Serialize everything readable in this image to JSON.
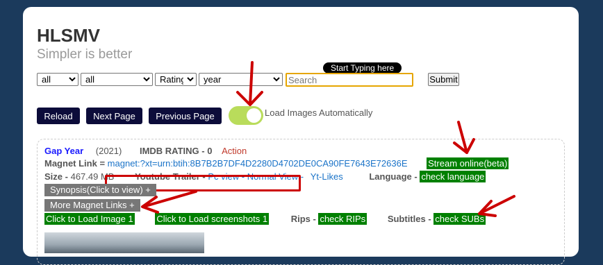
{
  "header": {
    "title": "HLSMV",
    "subtitle": "Simpler is better"
  },
  "filters": {
    "select1": "all",
    "select2": "all",
    "select3": "Rating",
    "select4": "year",
    "search_placeholder": "Search",
    "submit_label": "Submit",
    "tooltip": "Start Typing here"
  },
  "controls": {
    "reload": "Reload",
    "next_page": "Next Page",
    "previous_page": "Previous Page",
    "toggle_label": "Load Images Automatically",
    "toggle_on": true
  },
  "movie": {
    "title": "Gap Year",
    "year": "(2021)",
    "imdb_rating": "IMDB RATING - 0",
    "genre": "Action",
    "magnet_label": "Magnet Link =",
    "magnet_value": "magnet:?xt=urn:btih:8B7B2B7DF4D2280D4702DE0CA90FE7643E72636E",
    "stream_label": "Stream online(beta)",
    "size_label": "Size -",
    "size_value": "467.49 MB",
    "trailer_label": "Youtube Trailer -",
    "trailer_pc": "Pc view",
    "trailer_sep": "-",
    "trailer_normal": "Normal View",
    "trailer_sep2": "-",
    "trailer_likes": "Yt-Likes",
    "language_label": "Language -",
    "language_value": "check language",
    "synopsis": "Synopsis(Click to view) +",
    "more_magnets": "More Magnet Links +",
    "load_image": "Click to Load Image 1",
    "load_screens": "Click to Load screenshots 1",
    "rips_label": "Rips -",
    "rips_value": "check RIPs",
    "subtitles_label": "Subtitles -",
    "subtitles_value": "check SUBs"
  },
  "annotation_colors": {
    "arrow": "#cc0000",
    "toggle_bg": "#b9dc5b",
    "green_button": "#008000",
    "dark_button": "#0c0c3a",
    "page_bg": "#1b3a5c"
  }
}
